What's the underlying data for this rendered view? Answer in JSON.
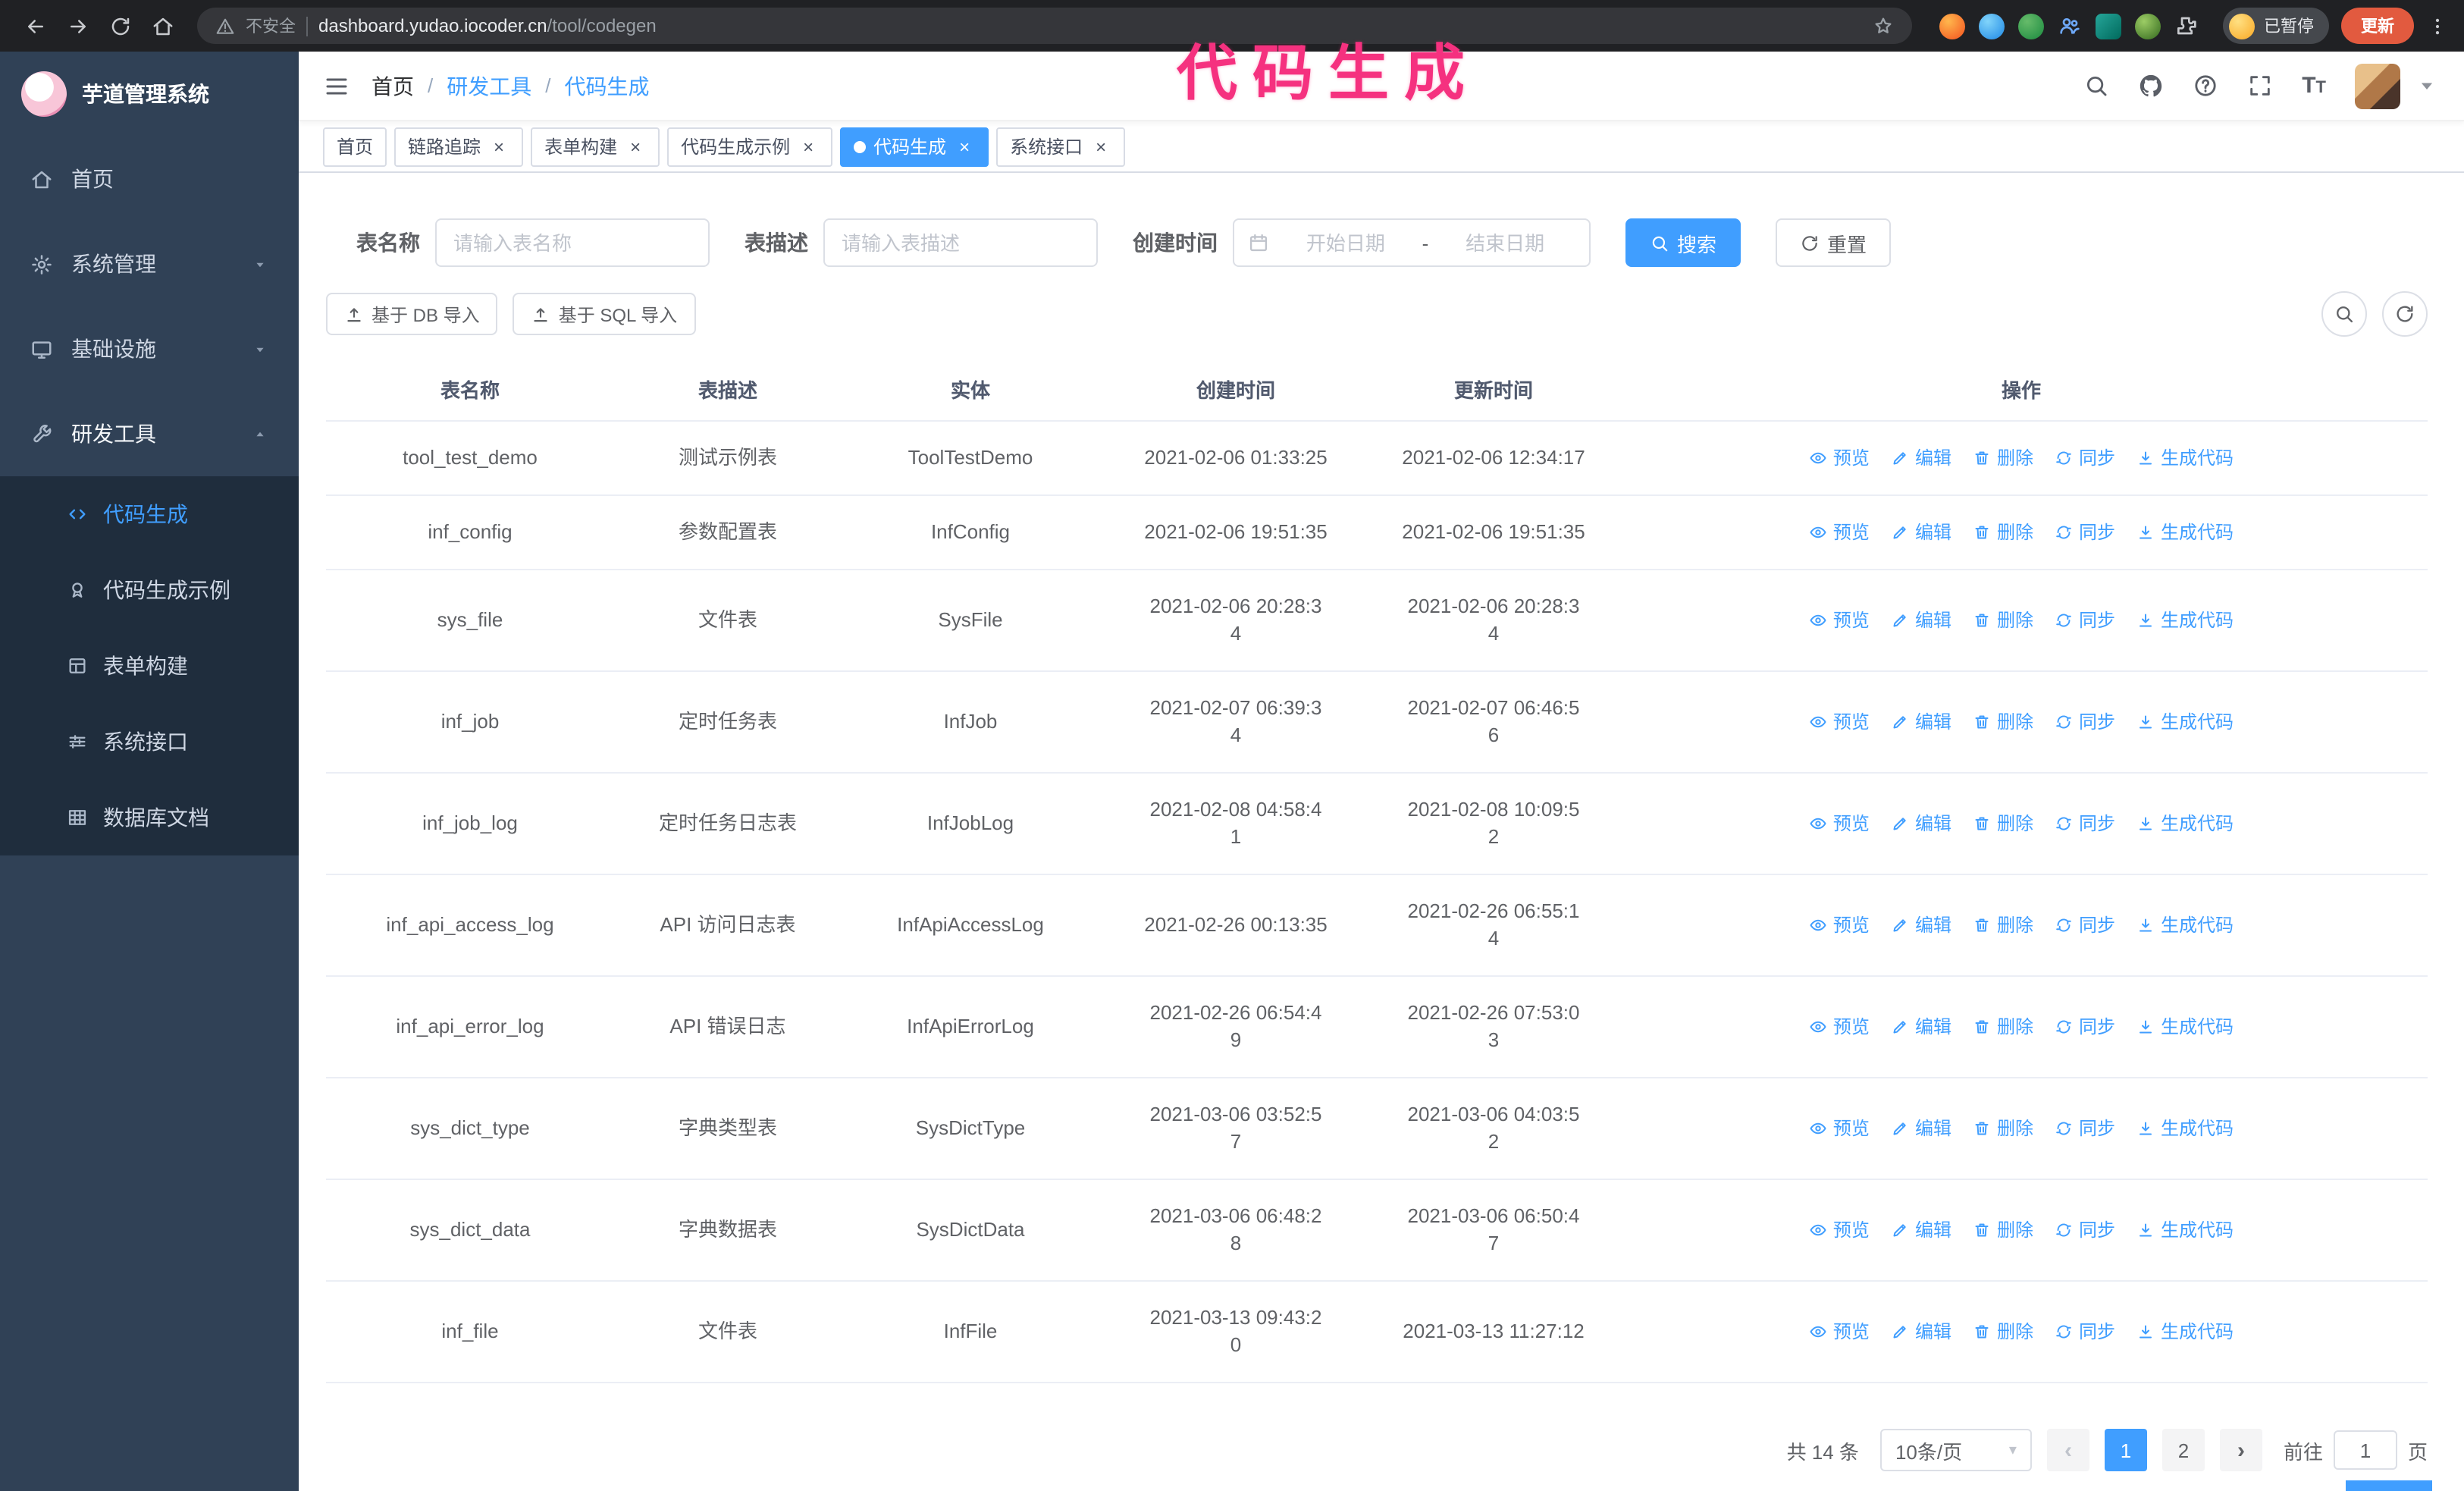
{
  "annotation": {
    "text": "代码生成"
  },
  "browser": {
    "security_label": "不安全",
    "url_host": "dashboard.yudao.iocoder.cn",
    "url_path": "/tool/codegen",
    "paused_badge": "已暂停",
    "update_button": "更新"
  },
  "sidebar": {
    "app_title": "芋道管理系统",
    "items": [
      {
        "label": "首页",
        "icon": "home-icon"
      },
      {
        "label": "系统管理",
        "icon": "gear-icon"
      },
      {
        "label": "基础设施",
        "icon": "monitor-icon"
      },
      {
        "label": "研发工具",
        "icon": "wrench-icon"
      }
    ],
    "submenu": [
      {
        "label": "代码生成",
        "icon": "code-icon",
        "active": true
      },
      {
        "label": "代码生成示例",
        "icon": "medal-icon",
        "active": false
      },
      {
        "label": "表单构建",
        "icon": "form-icon",
        "active": false
      },
      {
        "label": "系统接口",
        "icon": "sliders-icon",
        "active": false
      },
      {
        "label": "数据库文档",
        "icon": "table-icon",
        "active": false
      }
    ]
  },
  "breadcrumb": {
    "separator": "/",
    "items": [
      "首页",
      "研发工具",
      "代码生成"
    ]
  },
  "tags": [
    {
      "label": "首页",
      "closable": false,
      "active": false
    },
    {
      "label": "链路追踪",
      "closable": true,
      "active": false
    },
    {
      "label": "表单构建",
      "closable": true,
      "active": false
    },
    {
      "label": "代码生成示例",
      "closable": true,
      "active": false
    },
    {
      "label": "代码生成",
      "closable": true,
      "active": true
    },
    {
      "label": "系统接口",
      "closable": true,
      "active": false
    }
  ],
  "filters": {
    "name_label": "表名称",
    "name_placeholder": "请输入表名称",
    "desc_label": "表描述",
    "desc_placeholder": "请输入表描述",
    "time_label": "创建时间",
    "start_placeholder": "开始日期",
    "end_placeholder": "结束日期",
    "separator": "-",
    "search": "搜索",
    "reset": "重置"
  },
  "toolbar": {
    "import_db": "基于 DB 导入",
    "import_sql": "基于 SQL 导入"
  },
  "table": {
    "columns": [
      "表名称",
      "表描述",
      "实体",
      "创建时间",
      "更新时间",
      "操作"
    ],
    "ops": {
      "preview": "预览",
      "edit": "编辑",
      "delete": "删除",
      "sync": "同步",
      "generate": "生成代码"
    },
    "rows": [
      {
        "name": "tool_test_demo",
        "desc": "测试示例表",
        "entity": "ToolTestDemo",
        "created": "2021-02-06 01:33:25",
        "updated": "2021-02-06 12:34:17"
      },
      {
        "name": "inf_config",
        "desc": "参数配置表",
        "entity": "InfConfig",
        "created": "2021-02-06 19:51:35",
        "updated": "2021-02-06 19:51:35"
      },
      {
        "name": "sys_file",
        "desc": "文件表",
        "entity": "SysFile",
        "created": "2021-02-06 20:28:3\n4",
        "updated": "2021-02-06 20:28:3\n4"
      },
      {
        "name": "inf_job",
        "desc": "定时任务表",
        "entity": "InfJob",
        "created": "2021-02-07 06:39:3\n4",
        "updated": "2021-02-07 06:46:5\n6"
      },
      {
        "name": "inf_job_log",
        "desc": "定时任务日志表",
        "entity": "InfJobLog",
        "created": "2021-02-08 04:58:4\n1",
        "updated": "2021-02-08 10:09:5\n2"
      },
      {
        "name": "inf_api_access_log",
        "desc": "API 访问日志表",
        "entity": "InfApiAccessLog",
        "created": "2021-02-26 00:13:35",
        "updated": "2021-02-26 06:55:1\n4"
      },
      {
        "name": "inf_api_error_log",
        "desc": "API 错误日志",
        "entity": "InfApiErrorLog",
        "created": "2021-02-26 06:54:4\n9",
        "updated": "2021-02-26 07:53:0\n3"
      },
      {
        "name": "sys_dict_type",
        "desc": "字典类型表",
        "entity": "SysDictType",
        "created": "2021-03-06 03:52:5\n7",
        "updated": "2021-03-06 04:03:5\n2"
      },
      {
        "name": "sys_dict_data",
        "desc": "字典数据表",
        "entity": "SysDictData",
        "created": "2021-03-06 06:48:2\n8",
        "updated": "2021-03-06 06:50:4\n7"
      },
      {
        "name": "inf_file",
        "desc": "文件表",
        "entity": "InfFile",
        "created": "2021-03-13 09:43:2\n0",
        "updated": "2021-03-13 11:27:12"
      }
    ]
  },
  "pagination": {
    "total": "共 14 条",
    "page_size": "10条/页",
    "pages": [
      "1",
      "2"
    ],
    "active_page": "1",
    "goto_label": "前往",
    "goto_value": "1",
    "goto_unit": "页"
  },
  "colors": {
    "accent": "#409eff",
    "annotation_pink": "#f5317f",
    "sidebar_bg": "#304156",
    "submenu_bg": "#1f2d3d",
    "chrome_bg": "#202124",
    "update_button_bg": "#e25a3f"
  }
}
